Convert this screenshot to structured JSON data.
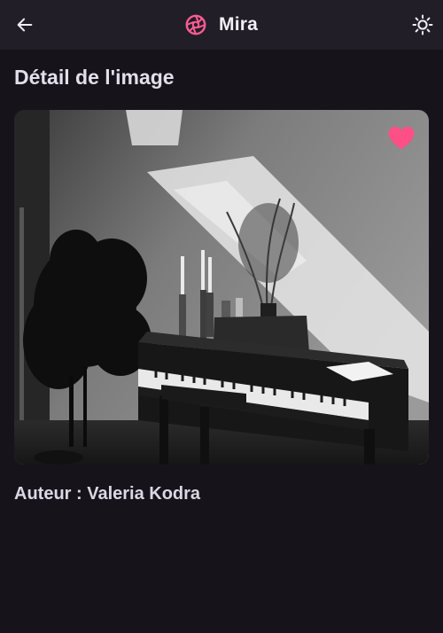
{
  "appbar": {
    "title": "Mira",
    "back_icon": "arrow-left-icon",
    "logo_icon": "aperture-icon",
    "theme_icon": "sun-icon",
    "accent_color": "#ff4f87"
  },
  "page": {
    "title": "Détail de l'image"
  },
  "image": {
    "favorite_icon": "heart-icon",
    "favorite_color": "#ff4f87",
    "favorited": true
  },
  "author": {
    "text": "Auteur : Valeria Kodra"
  }
}
